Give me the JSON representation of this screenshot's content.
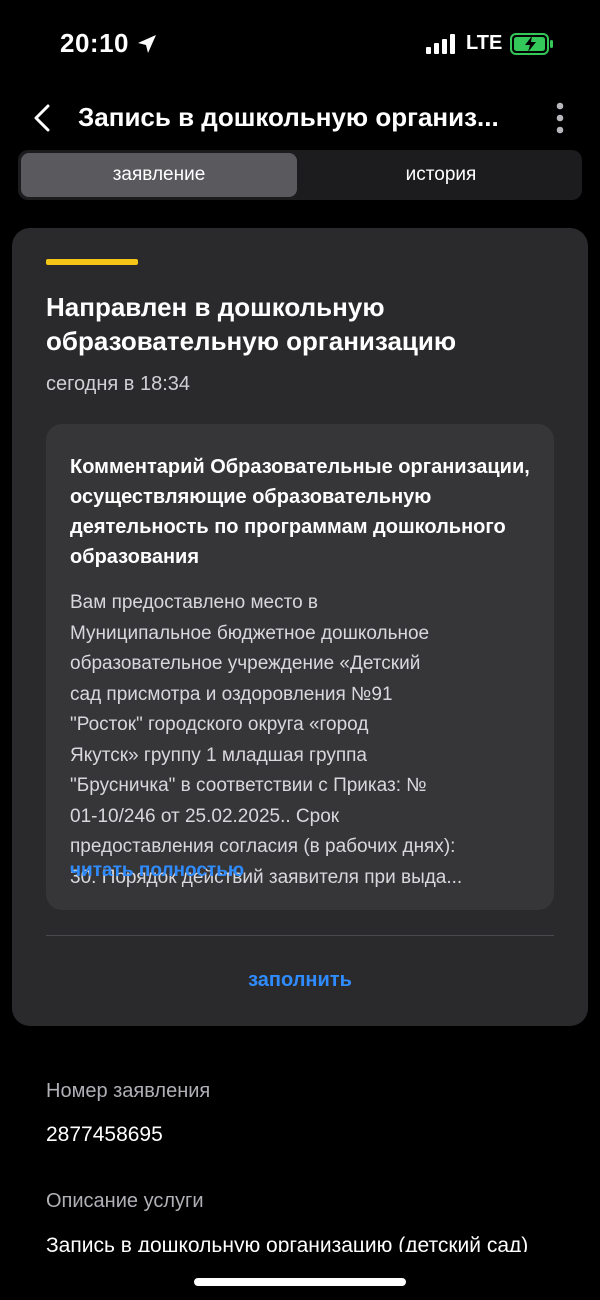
{
  "status_bar": {
    "time": "20:10",
    "network": "LTE",
    "icons": {
      "location": "location-arrow-icon",
      "signal": "signal-bars-icon",
      "battery": "battery-charging-icon"
    }
  },
  "header": {
    "title": "Запись в дошкольную организ...",
    "back_icon": "chevron-left-icon",
    "more_icon": "more-vertical-icon"
  },
  "tabs": [
    {
      "label": "заявление",
      "active": true
    },
    {
      "label": "история",
      "active": false
    }
  ],
  "status_card": {
    "accent_color": "#f5c518",
    "title": "Направлен в дошкольную образовательную организацию",
    "time": "сегодня в 18:34",
    "comment": {
      "title": "Комментарий Образовательные организации, осуществляющие образовательную деятельность по программам дошкольного образования",
      "body_lines": [
        "Вам предоставлено место в",
        "Муниципальное бюджетное дошкольное",
        "образовательное учреждение «Детский",
        "сад присмотра и оздоровления №91",
        "\"Росток\" городского округа «город",
        "Якутск» группу 1 младшая группа",
        "\"Брусничка\" в соответствии с Приказ: №",
        "01-10/246 от 25.02.2025.. Срок",
        "предоставления согласия (в рабочих днях):",
        "30. Порядок действий заявителя при выда..."
      ],
      "read_more": "читать полностью"
    },
    "action_button": "заполнить"
  },
  "application": {
    "number_label": "Номер заявления",
    "number_value": "2877458695",
    "description_label": "Описание услуги",
    "description_value": "Запись в дошкольную организацию (детский сад)"
  },
  "colors": {
    "background": "#000000",
    "card": "#2a2a2c",
    "link": "#2f8cff",
    "battery": "#34c759"
  }
}
